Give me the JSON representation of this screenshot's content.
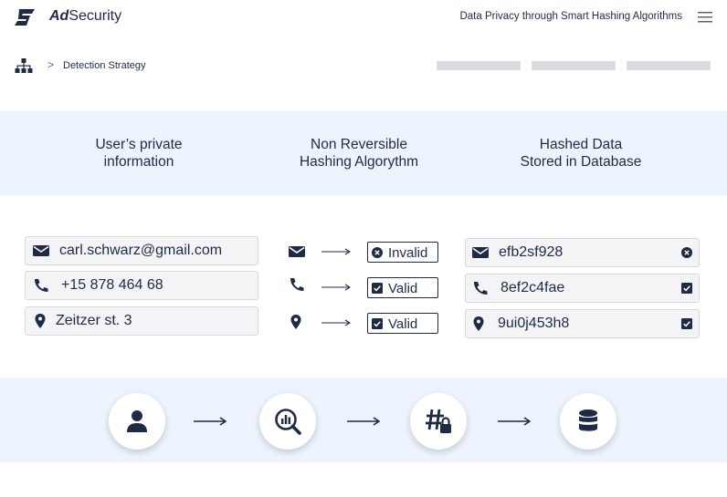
{
  "header": {
    "brand_bold": "Ad",
    "brand_rest": "Security",
    "tagline": "Data Privacy through Smart Hashing Algorithms"
  },
  "breadcrumb": {
    "separator": ">",
    "current": "Detection Strategy"
  },
  "columns": {
    "col1": "User’s private\ninformation",
    "col2": "Non Reversible\nHashing Algorythm",
    "col3": "Hashed Data\nStored in Database"
  },
  "rows": [
    {
      "icon": "envelope-icon",
      "input": "carl.schwarz@gmail.com",
      "status": "Invalid",
      "status_icon": "x-circle-icon",
      "hash": "efb2sf928",
      "hash_icon": "x-circle-icon"
    },
    {
      "icon": "phone-icon",
      "input": "+15 878 464 68",
      "status": "Valid",
      "status_icon": "checkbox-checked-icon",
      "hash": "8ef2c4fae",
      "hash_icon": "checkbox-checked-icon"
    },
    {
      "icon": "map-pin-icon",
      "input": "Zeitzer st. 3",
      "status": "Valid",
      "status_icon": "checkbox-checked-icon",
      "hash": "9ui0j453h8",
      "hash_icon": "checkbox-checked-icon"
    }
  ],
  "flow": [
    "user-icon",
    "magnify-chart-icon",
    "hash-lock-icon",
    "database-icon"
  ],
  "colors": {
    "text": "#1f2a44",
    "band": "#edf4fd",
    "field_bg": "#f4f4f6",
    "field_border": "#d7d9de",
    "skeleton": "#d9dbdf"
  }
}
